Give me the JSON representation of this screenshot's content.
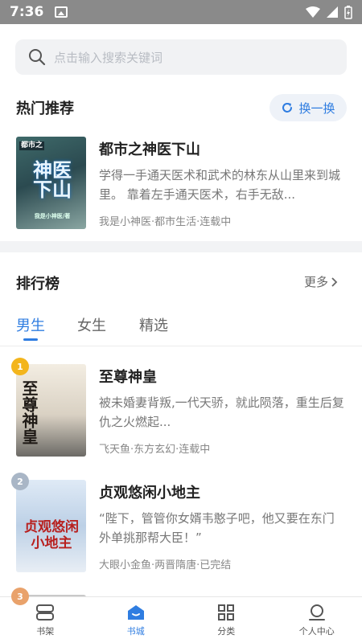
{
  "status": {
    "time": "7:36"
  },
  "search": {
    "placeholder": "点击输入搜索关键词"
  },
  "hot": {
    "title": "热门推荐",
    "refresh_label": "换一换",
    "book": {
      "title": "都市之神医下山",
      "desc": "学得一手通天医术和武术的林东从山里来到城里。 靠着左手通天医术，右手无敌...",
      "meta": "我是小神医·都市生活·连载中",
      "cover_text": "神医下山",
      "cover_small": "都市之",
      "cover_author": "我是小神医/著"
    }
  },
  "ranking": {
    "title": "排行榜",
    "more_label": "更多",
    "tabs": [
      "男生",
      "女生",
      "精选"
    ],
    "active_tab": 0,
    "books": [
      {
        "rank": "1",
        "title": "至尊神皇",
        "desc": "被未婚妻背叛,一代天骄，就此陨落，重生后复仇之火燃起...",
        "meta": "飞天鱼·东方玄幻·连载中",
        "cover_text": "至尊神皇",
        "badge_color": "#f3b51c"
      },
      {
        "rank": "2",
        "title": "贞观悠闲小地主",
        "desc": "“陛下，管管你女婿韦憨子吧，他又要在东门外单挑那帮大臣！”",
        "meta": "大眼小金鱼·两晋隋唐·已完结",
        "cover_text": "贞观悠闲小地主",
        "badge_color": "#a9b6c6"
      },
      {
        "rank": "3",
        "badge_color": "#e9a26b"
      }
    ]
  },
  "nav": {
    "items": [
      {
        "label": "书架",
        "icon": "bookshelf-icon"
      },
      {
        "label": "书城",
        "icon": "bookstore-icon"
      },
      {
        "label": "分类",
        "icon": "category-icon"
      },
      {
        "label": "个人中心",
        "icon": "profile-icon"
      }
    ],
    "active": 1
  },
  "colors": {
    "accent": "#2f7de1",
    "status_bar": "#8a8a8a"
  }
}
